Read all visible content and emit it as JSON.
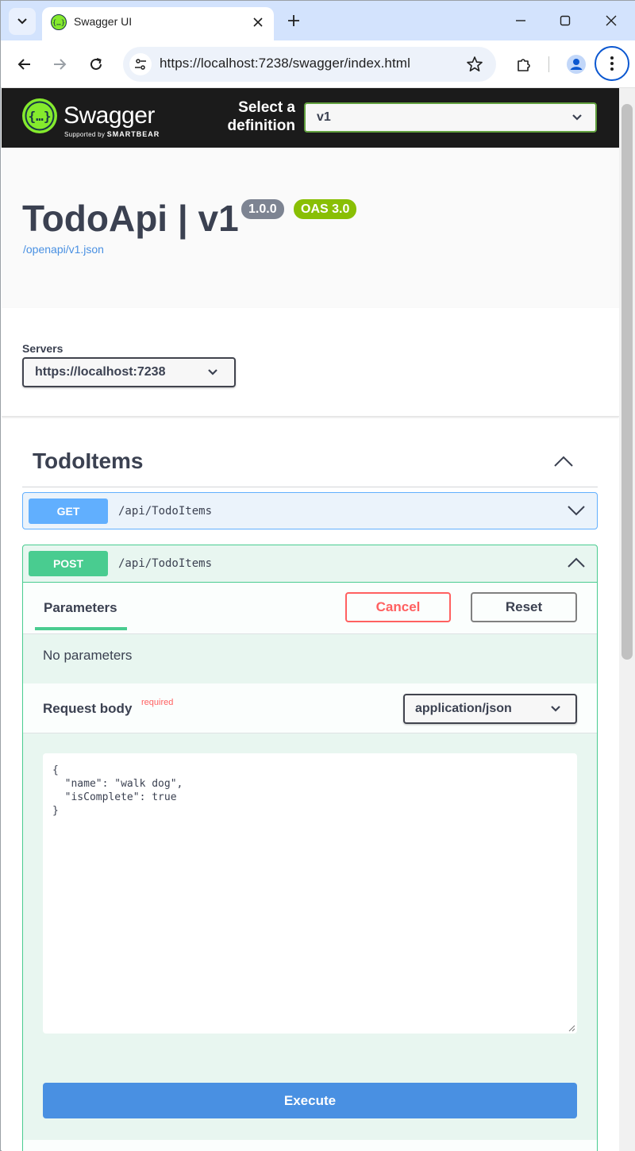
{
  "browser": {
    "tab_title": "Swagger UI",
    "url": "https://localhost:7238/swagger/index.html"
  },
  "swagger_header": {
    "brand": "Swagger",
    "supported_by": "Supported by",
    "supported_by_brand": "SMARTBEAR",
    "select_label": "Select a definition",
    "definition_value": "v1"
  },
  "info": {
    "title": "TodoApi | v1",
    "version_badge": "1.0.0",
    "oas_badge": "OAS 3.0",
    "spec_link": "/openapi/v1.json"
  },
  "servers": {
    "label": "Servers",
    "selected": "https://localhost:7238"
  },
  "tag": {
    "name": "TodoItems"
  },
  "operations": [
    {
      "method": "GET",
      "path": "/api/TodoItems",
      "expanded": false
    },
    {
      "method": "POST",
      "path": "/api/TodoItems",
      "expanded": true
    }
  ],
  "post_panel": {
    "parameters_tab": "Parameters",
    "cancel_label": "Cancel",
    "reset_label": "Reset",
    "no_params": "No parameters",
    "request_body_label": "Request body",
    "required_label": "required",
    "content_type": "application/json",
    "body_lines": [
      "{",
      "  \"name\": \"walk dog\",",
      "  \"isComplete\": true",
      "}"
    ],
    "execute_label": "Execute"
  },
  "colors": {
    "get": "#61affe",
    "post": "#49cc90",
    "cancel": "#ff6060",
    "execute": "#4990e2",
    "header_bg": "#1b1b1b",
    "oas_badge": "#89bf04"
  }
}
